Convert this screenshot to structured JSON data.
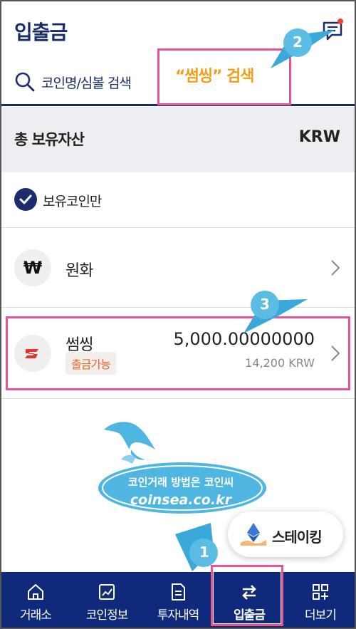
{
  "header": {
    "title": "입출금",
    "chat_icon": "chat-bubble-icon"
  },
  "search": {
    "icon": "search-icon",
    "placeholder": "코인명/심볼 검색"
  },
  "callouts": {
    "search_hint": "“썸씽” 검색",
    "markers": [
      "1",
      "2",
      "3"
    ]
  },
  "assets": {
    "label": "총 보유자산",
    "currency": "KRW"
  },
  "filter": {
    "label": "보유코인만",
    "checked": true
  },
  "coins": [
    {
      "name": "원화",
      "icon": "won-icon"
    },
    {
      "name": "썸씽",
      "icon": "ssx-logo-icon",
      "badge": "출금가능",
      "amount": "5,000.00000000",
      "krw": "14,200 KRW"
    }
  ],
  "watermark": {
    "line1": "코인거래 방법은 코인씨",
    "line2": "coinsea.co.kr"
  },
  "staking": {
    "label": "스테이킹",
    "icon": "ethereum-hand-icon"
  },
  "nav": {
    "items": [
      {
        "label": "거래소",
        "icon": "home-icon"
      },
      {
        "label": "코인정보",
        "icon": "chart-icon"
      },
      {
        "label": "투자내역",
        "icon": "document-icon"
      },
      {
        "label": "입출금",
        "icon": "transfer-icon",
        "active": true
      },
      {
        "label": "더보기",
        "icon": "more-grid-icon"
      }
    ]
  },
  "colors": {
    "navy": "#1a2c6b",
    "nav_bg": "#0f2a7a",
    "highlight_pink": "#e8539a",
    "search_hint": "#f0a01c",
    "badge_text": "#e46a2c",
    "marker_blue": "#3aa8d8"
  }
}
